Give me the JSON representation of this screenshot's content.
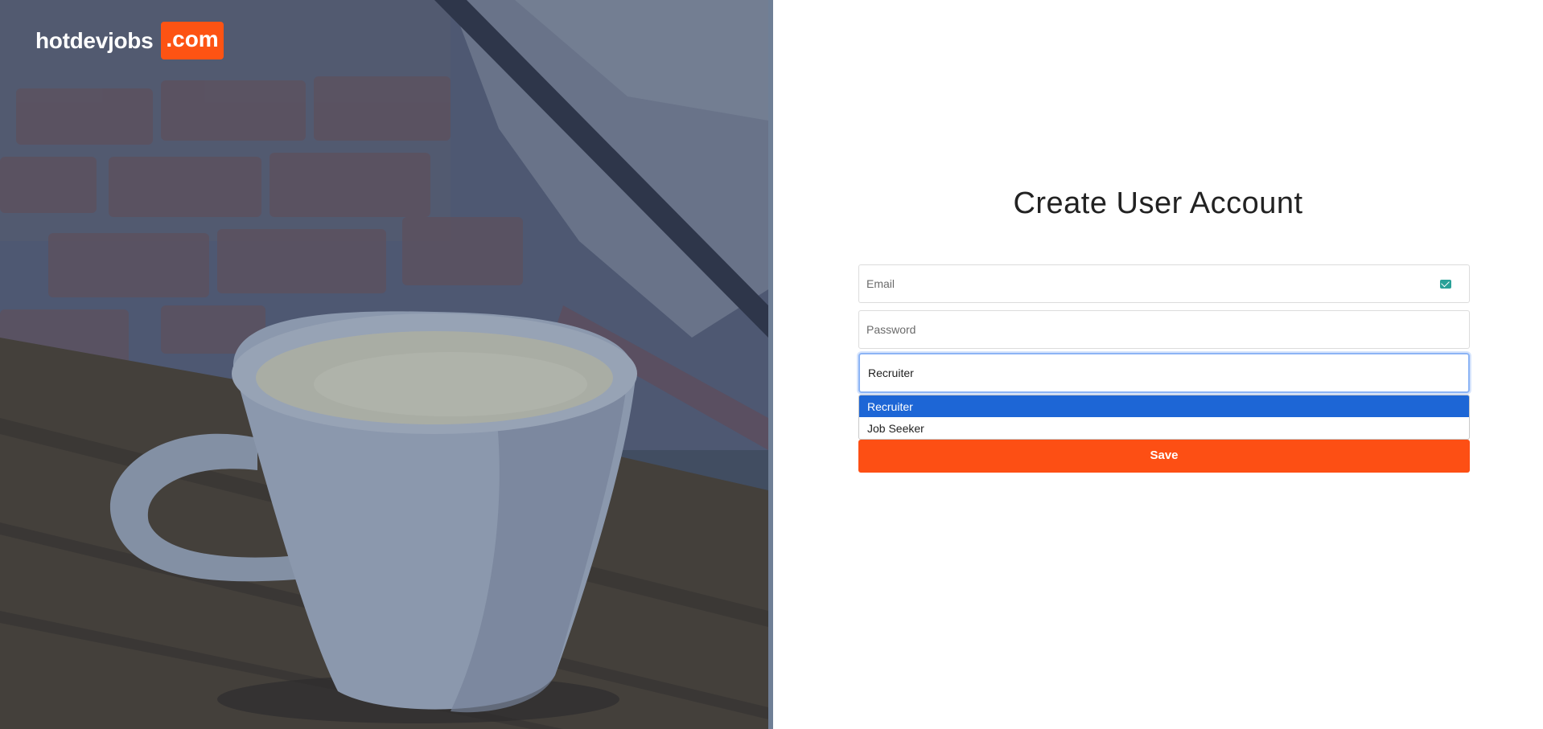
{
  "logo": {
    "name": "hotdevjobs",
    "tld": ".com"
  },
  "page": {
    "title": "Create User Account"
  },
  "form": {
    "email_placeholder": "Email",
    "password_placeholder": "Password",
    "role_selected": "Recruiter",
    "role_options": [
      "Recruiter",
      "Job Seeker"
    ],
    "save_label": "Save"
  },
  "colors": {
    "accent": "#fd5313",
    "selected_option": "#1d66d6",
    "focus_border": "#8cb4f5"
  },
  "icons": {
    "email": "mail-check-icon"
  }
}
